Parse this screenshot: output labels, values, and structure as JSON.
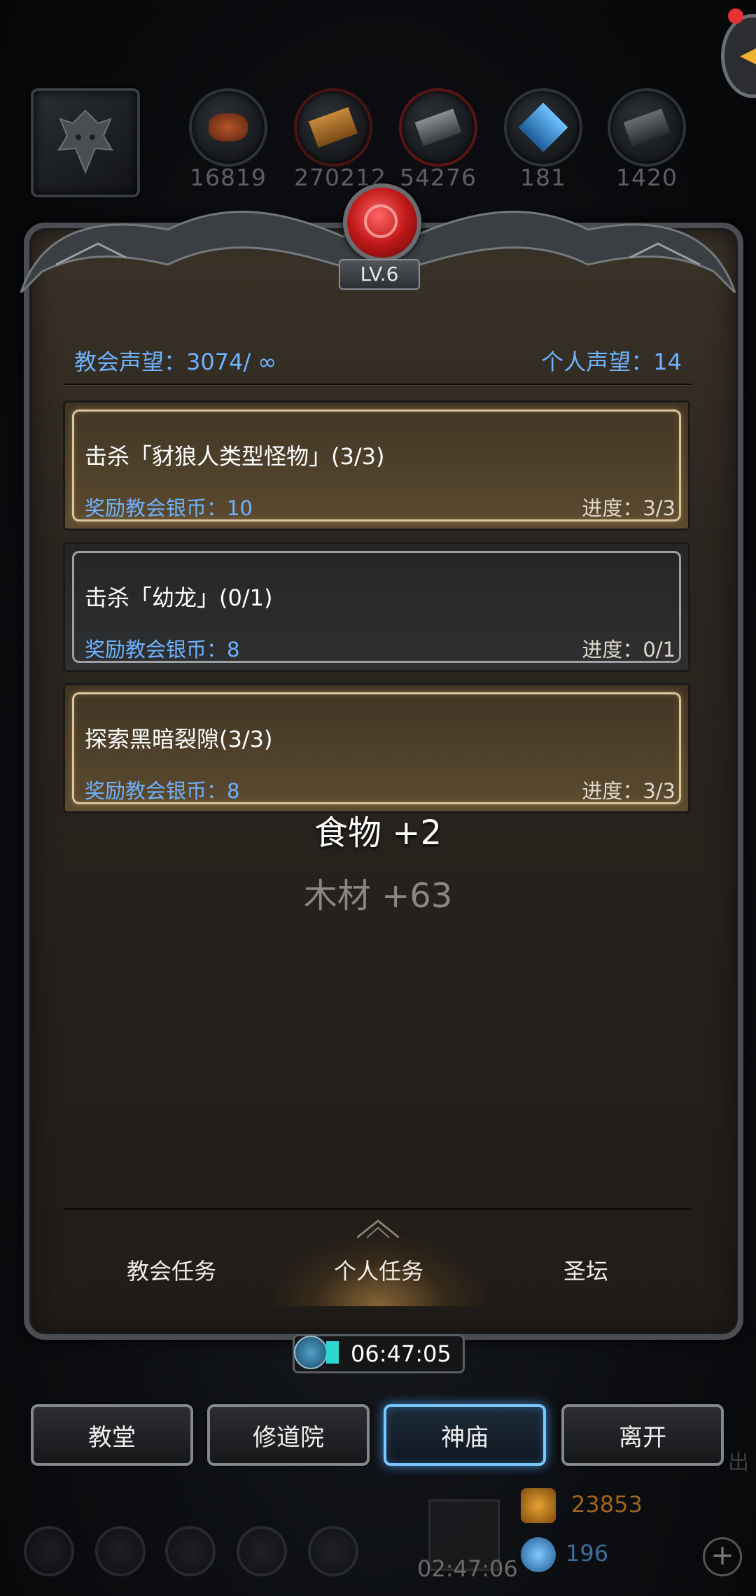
{
  "resources": [
    {
      "icon": "meat-icon",
      "value": "16819"
    },
    {
      "icon": "wood-icon",
      "value": "270212"
    },
    {
      "icon": "iron-icon",
      "value": "54276"
    },
    {
      "icon": "crystal-icon",
      "value": "181"
    },
    {
      "icon": "stone-icon",
      "value": "1420"
    }
  ],
  "level": "LV.6",
  "church_reputation": "教会声望：3074/ ∞",
  "personal_reputation": "个人声望：14",
  "quests": [
    {
      "title": "击杀「豺狼人类型怪物」(3/3)",
      "reward": "奖励教会银币：10",
      "progress": "进度：3/3",
      "status": "done"
    },
    {
      "title": "击杀「幼龙」(0/1)",
      "reward": "奖励教会银币：8",
      "progress": "进度：0/1",
      "status": "pending"
    },
    {
      "title": "探索黑暗裂隙(3/3)",
      "reward": "奖励教会银币：8",
      "progress": "进度：3/3",
      "status": "done"
    }
  ],
  "floating": {
    "food": "食物 +2",
    "wood": "木材 +63"
  },
  "tabs": [
    {
      "label": "教会任务",
      "active": false
    },
    {
      "label": "个人任务",
      "active": true
    },
    {
      "label": "圣坛",
      "active": false
    }
  ],
  "timer": "06:47:05",
  "nav": [
    {
      "label": "教堂",
      "active": false
    },
    {
      "label": "修道院",
      "active": false
    },
    {
      "label": "神庙",
      "active": true
    },
    {
      "label": "离开",
      "active": false
    }
  ],
  "hud": {
    "gift_timer": "02:47:06",
    "gold": "23853",
    "gems": "196",
    "side_label": "出"
  },
  "colors": {
    "accent_blue": "#6fb2ff",
    "active_glow": "#7cc6ff"
  }
}
